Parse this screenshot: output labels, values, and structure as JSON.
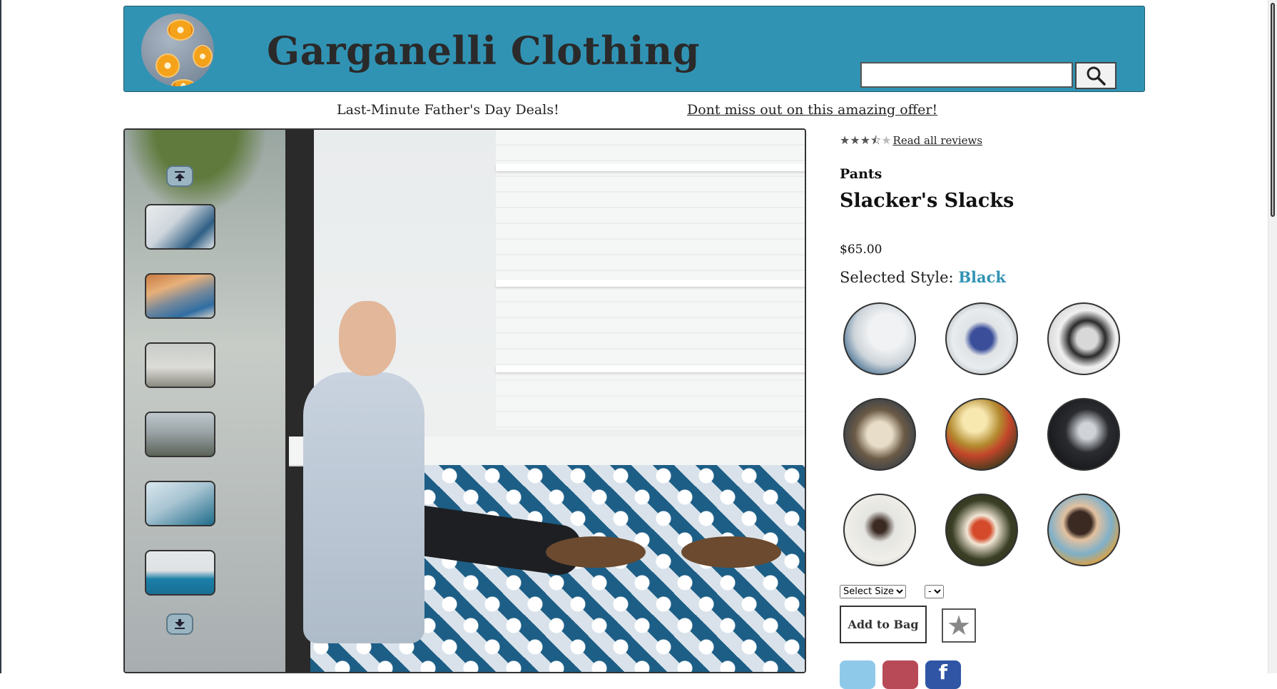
{
  "header": {
    "brand": "Garganelli Clothing",
    "search": {
      "value": "",
      "placeholder": ""
    },
    "accent_color": "#3193b4"
  },
  "banner": {
    "promo": "Last-Minute Father's Day Deals!",
    "offer_link": "Dont miss out on this amazing offer!"
  },
  "gallery": {
    "up_icon": "scroll-up-icon",
    "down_icon": "scroll-down-icon",
    "thumbnail_count": 6
  },
  "product": {
    "rating": 3.5,
    "rating_max": 5,
    "reviews_link": "Read all reviews",
    "category": "Pants",
    "name": "Slacker's Slacks",
    "price": "$65.00",
    "style_label": "Selected Style:",
    "selected_style": "Black",
    "style_count": 9
  },
  "controls": {
    "size_select": {
      "selected": "Select Size"
    },
    "qty_select": {
      "selected": "-"
    },
    "add_to_bag": "Add to Bag",
    "favorite_icon": "star-icon"
  },
  "share": [
    {
      "name": "twitter-icon",
      "glyph": "",
      "color": "#8fc9ea"
    },
    {
      "name": "pinterest-icon",
      "glyph": "",
      "color": "#b84a58"
    },
    {
      "name": "facebook-icon",
      "glyph": "f",
      "color": "#2f55a4"
    }
  ]
}
